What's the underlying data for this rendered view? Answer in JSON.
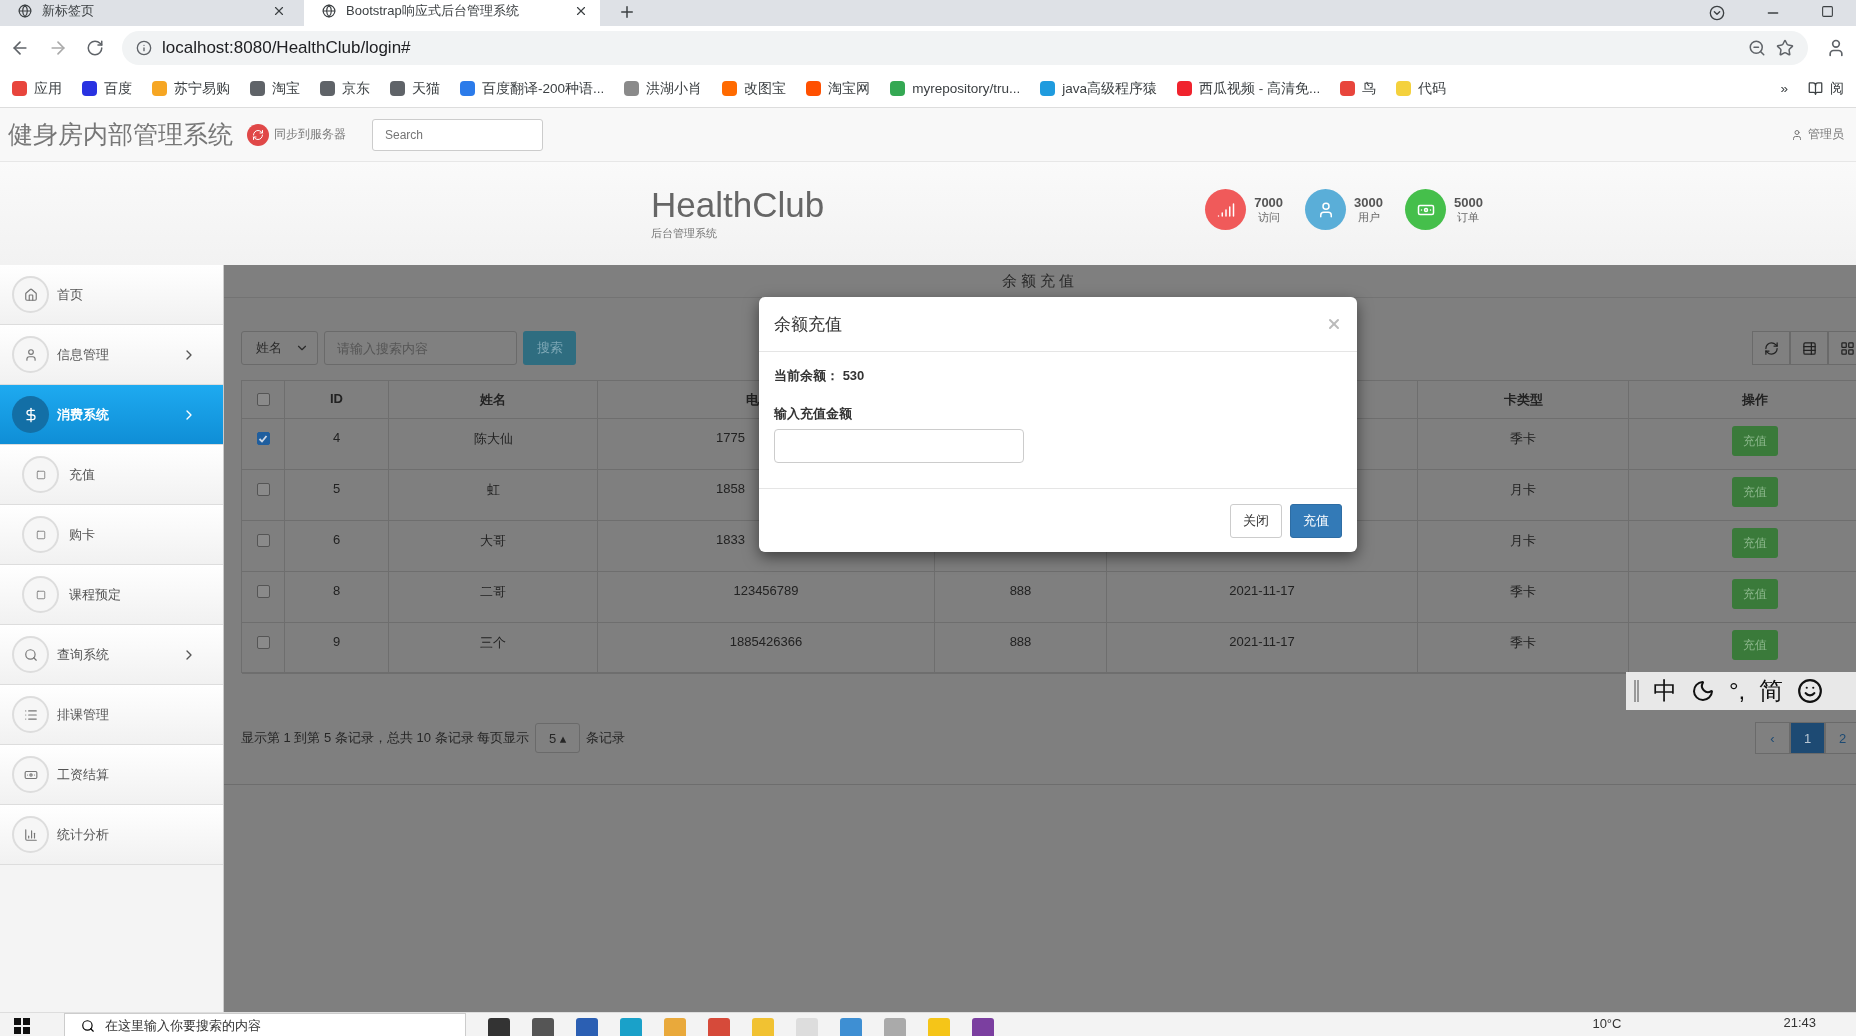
{
  "browser": {
    "tabs": [
      {
        "label": "新标签页",
        "selected": false
      },
      {
        "label": "Bootstrap响应式后台管理系统",
        "selected": true
      }
    ],
    "address": "localhost:8080/HealthClub/login#",
    "bookmarks": [
      {
        "label": "应用",
        "color": "#e8453c"
      },
      {
        "label": "百度",
        "color": "#2932e1"
      },
      {
        "label": "苏宁易购",
        "color": "#f6a623"
      },
      {
        "label": "淘宝",
        "color": "#5f6368"
      },
      {
        "label": "京东",
        "color": "#5f6368"
      },
      {
        "label": "天猫",
        "color": "#5f6368"
      },
      {
        "label": "百度翻译-200种语...",
        "color": "#2b7bea"
      },
      {
        "label": "洪湖小肖",
        "color": "#8a8a8a"
      },
      {
        "label": "改图宝",
        "color": "#ff6a00"
      },
      {
        "label": "淘宝网",
        "color": "#ff5000"
      },
      {
        "label": "myrepository/tru...",
        "color": "#34a853"
      },
      {
        "label": "java高级程序猿",
        "color": "#1f9bde"
      },
      {
        "label": "西瓜视频 - 高清免...",
        "color": "#f0232d"
      },
      {
        "label": "鸟",
        "color": "#e8453c"
      },
      {
        "label": "代码",
        "color": "#f4d13d"
      }
    ],
    "more": "»",
    "reading": "阅"
  },
  "navbar": {
    "brand": "健身房内部管理系统",
    "sync": "同步到服务器",
    "search_placeholder": "Search",
    "user": "管理员"
  },
  "header": {
    "title": "HealthClub",
    "subtitle": "后台管理系统",
    "stats": [
      {
        "kind": "signal",
        "value": "7000",
        "label": "访问",
        "color": "#f05a5a"
      },
      {
        "kind": "user",
        "value": "3000",
        "label": "用户",
        "color": "#5aaed8"
      },
      {
        "kind": "money",
        "value": "5000",
        "label": "订单",
        "color": "#45bf4b"
      }
    ]
  },
  "sidebar": {
    "items": [
      {
        "label": "首页",
        "kind": "home",
        "selected": false,
        "submenu": false
      },
      {
        "label": "信息管理",
        "kind": "user",
        "selected": false,
        "submenu": true
      },
      {
        "label": "消费系统",
        "kind": "dollar",
        "selected": true,
        "submenu": true,
        "children": [
          {
            "label": "充值",
            "selected": false
          },
          {
            "label": "购卡",
            "selected": false
          },
          {
            "label": "课程预定",
            "selected": false
          }
        ]
      },
      {
        "label": "查询系统",
        "kind": "search",
        "selected": false,
        "submenu": true
      },
      {
        "label": "排课管理",
        "kind": "list",
        "selected": false,
        "submenu": false
      },
      {
        "label": "工资结算",
        "kind": "money",
        "selected": false,
        "submenu": false
      },
      {
        "label": "统计分析",
        "kind": "chart",
        "selected": false,
        "submenu": false
      }
    ]
  },
  "content": {
    "title": "余额充值",
    "filter": {
      "field": "姓名",
      "placeholder": "请输入搜索内容",
      "button": "搜索"
    },
    "table": {
      "select_all": {
        "checked": false
      },
      "columns": [
        {
          "kind": "text",
          "label": "ID"
        },
        {
          "kind": "text",
          "label": "姓名"
        },
        {
          "kind": "cut",
          "label": "电"
        },
        {
          "kind": "hidden"
        },
        {
          "kind": "hidden"
        },
        {
          "kind": "text",
          "label": "卡类型"
        },
        {
          "kind": "action",
          "label": "操作"
        }
      ],
      "rows": [
        {
          "checked": true,
          "cells": [
            "4",
            "陈大仙",
            "1775",
            null,
            null,
            "季卡",
            "充值"
          ]
        },
        {
          "checked": false,
          "cells": [
            "5",
            "虹",
            "1858",
            null,
            null,
            "月卡",
            "充值"
          ]
        },
        {
          "checked": false,
          "cells": [
            "6",
            "大哥",
            "1833",
            null,
            null,
            "月卡",
            "充值"
          ]
        },
        {
          "checked": false,
          "cells": [
            "8",
            "二哥",
            "123456789",
            "888",
            "2021-11-17",
            "季卡",
            "充值"
          ]
        },
        {
          "checked": false,
          "cells": [
            "9",
            "三个",
            "1885426366",
            "888",
            "2021-11-17",
            "季卡",
            "充值"
          ]
        }
      ]
    },
    "pagination": {
      "summary": "显示第 1 到第 5 条记录，总共 10 条记录 每页显示",
      "page_size": "5",
      "page_size_caret": "▴",
      "suffix": "条记录",
      "pages": [
        {
          "label": "‹",
          "selected": false
        },
        {
          "label": "1",
          "selected": true
        },
        {
          "label": "2",
          "selected": false
        }
      ]
    }
  },
  "ime": {
    "items": [
      {
        "kind": "text",
        "label": "中"
      },
      {
        "kind": "moon"
      },
      {
        "kind": "text",
        "label": "°,"
      },
      {
        "kind": "text",
        "label": "简"
      },
      {
        "kind": "smile"
      }
    ]
  },
  "modal": {
    "title": "余额充值",
    "balance_label": "当前余额：",
    "balance": "530",
    "amount_label": "输入充值金额",
    "buttons": [
      {
        "label": "关闭",
        "kind": "default"
      },
      {
        "label": "充值",
        "kind": "primary"
      }
    ]
  },
  "taskbar": {
    "search_placeholder": "在这里输入你要搜索的内容",
    "weather": "10°C",
    "time": "21:43"
  }
}
